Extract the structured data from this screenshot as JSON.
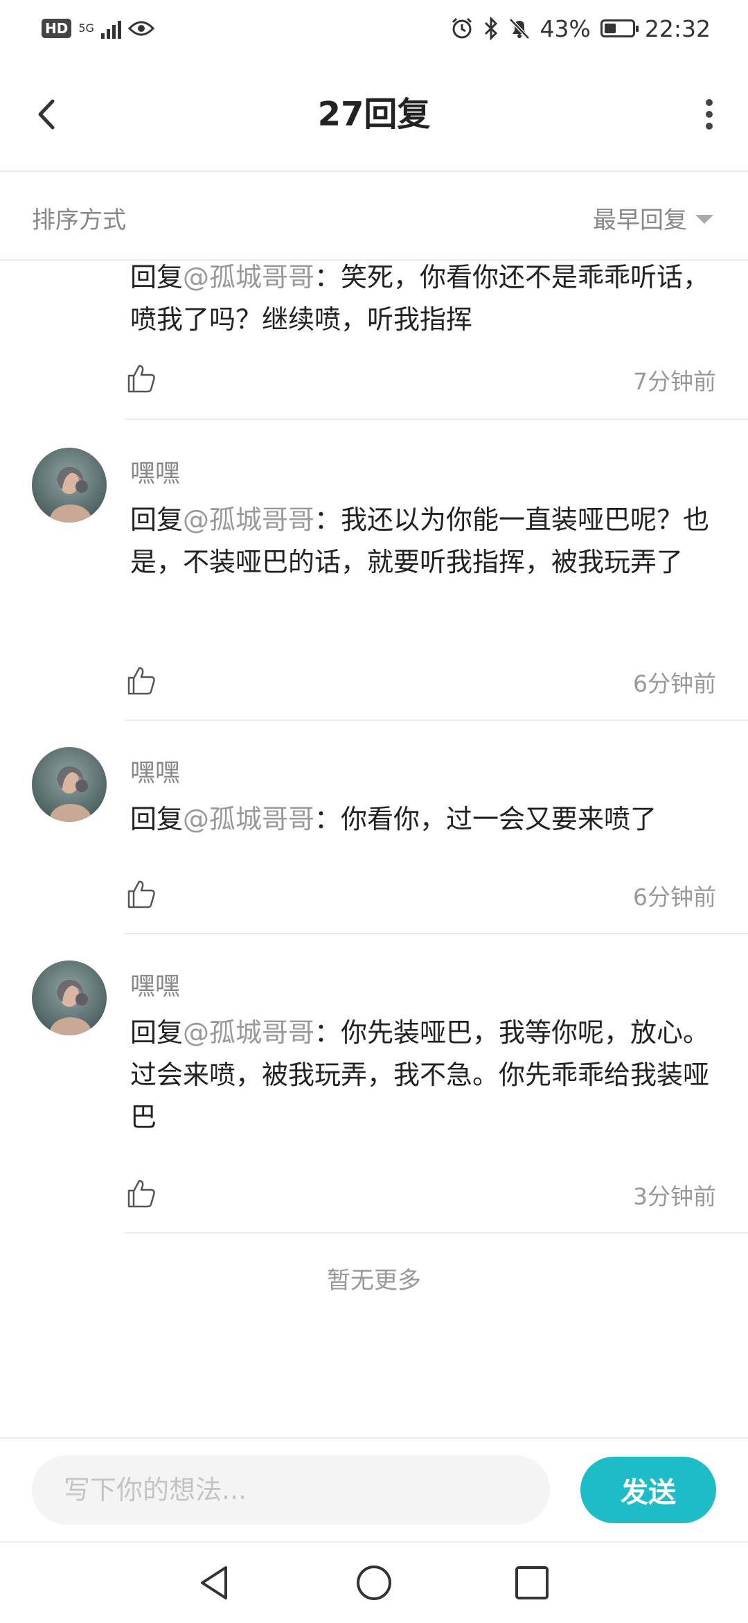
{
  "status_bar": {
    "hd_label": "HD",
    "network_label": "5G",
    "battery_percent": "43%",
    "battery_level": 0.43,
    "time": "22:32"
  },
  "header": {
    "title": "27回复"
  },
  "sort_bar": {
    "label": "排序方式",
    "selected": "最早回复"
  },
  "comments": [
    {
      "name": "",
      "prefix": "回复",
      "mention": "@孤城哥哥",
      "text": "：笑死，你看你还不是乖乖听话，喷我了吗？继续喷，听我指挥",
      "time": "7分钟前"
    },
    {
      "name": "嘿嘿",
      "prefix": "回复",
      "mention": "@孤城哥哥",
      "text": "：我还以为你能一直装哑巴呢？也是，不装哑巴的话，就要听我指挥，被我玩弄了",
      "time": "6分钟前"
    },
    {
      "name": "嘿嘿",
      "prefix": "回复",
      "mention": "@孤城哥哥",
      "text": "：你看你，过一会又要来喷了",
      "time": "6分钟前"
    },
    {
      "name": "嘿嘿",
      "prefix": "回复",
      "mention": "@孤城哥哥",
      "text": "：你先装哑巴，我等你呢，放心。过会来喷，被我玩弄，我不急。你先乖乖给我装哑巴",
      "time": "3分钟前"
    }
  ],
  "footer": {
    "no_more": "暂无更多"
  },
  "input_bar": {
    "placeholder": "写下你的想法...",
    "send_label": "发送"
  },
  "colors": {
    "accent": "#1ebcc6",
    "muted_text": "#888888"
  }
}
